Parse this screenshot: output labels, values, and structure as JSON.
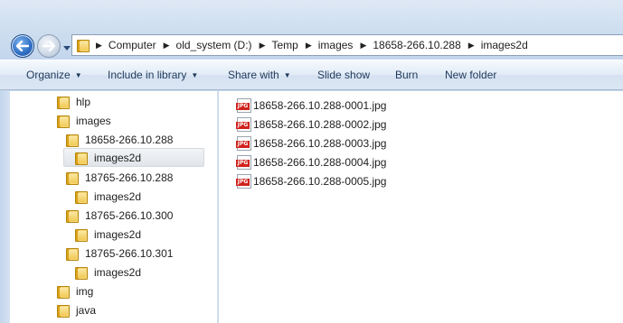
{
  "navigation": {
    "back_icon": "back-arrow-icon",
    "forward_icon": "forward-arrow-icon",
    "dropdown_icon": "chevron-down-icon"
  },
  "breadcrumb": [
    "Computer",
    "old_system (D:)",
    "Temp",
    "images",
    "18658-266.10.288",
    "images2d"
  ],
  "toolbar": {
    "organize": "Organize",
    "include_in_library": "Include in library",
    "share_with": "Share with",
    "slide_show": "Slide show",
    "burn": "Burn",
    "new_folder": "New folder"
  },
  "tree": [
    {
      "label": "hlp"
    },
    {
      "label": "images"
    },
    {
      "label": "18658-266.10.288"
    },
    {
      "label": "images2d",
      "selected": true
    },
    {
      "label": "18765-266.10.288"
    },
    {
      "label": "images2d"
    },
    {
      "label": "18765-266.10.300"
    },
    {
      "label": "images2d"
    },
    {
      "label": "18765-266.10.301"
    },
    {
      "label": "images2d"
    },
    {
      "label": "img"
    },
    {
      "label": "java"
    }
  ],
  "files": [
    {
      "name": "18658-266.10.288-0001.jpg"
    },
    {
      "name": "18658-266.10.288-0002.jpg"
    },
    {
      "name": "18658-266.10.288-0003.jpg"
    },
    {
      "name": "18658-266.10.288-0004.jpg"
    },
    {
      "name": "18658-266.10.288-0005.jpg"
    }
  ],
  "file_icon_label": "JPG",
  "colors": {
    "toolbar_text": "#1e395b",
    "folder": "#f2c955",
    "jpg_badge": "#d0221d"
  }
}
